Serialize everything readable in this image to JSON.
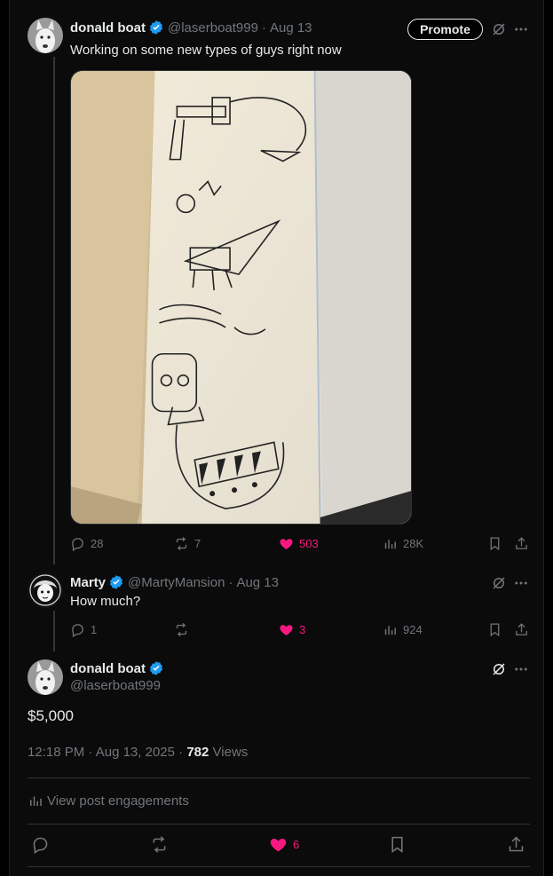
{
  "tweet1": {
    "name": "donald boat",
    "handle": "@laserboat999",
    "date": "Aug 13",
    "promote_label": "Promote",
    "text": "Working on some new types of guys right now",
    "replies": "28",
    "reposts": "7",
    "likes": "503",
    "views": "28K"
  },
  "tweet2": {
    "name": "Marty",
    "handle": "@MartyMansion",
    "date": "Aug 13",
    "text": "How much?",
    "replies": "1",
    "reposts": "",
    "likes": "3",
    "views": "924"
  },
  "tweet3": {
    "name": "donald boat",
    "handle": "@laserboat999",
    "text": "$5,000",
    "time": "12:18 PM",
    "date": "Aug 13, 2025",
    "views_count": "782",
    "views_label": "Views",
    "engagements_label": "View post engagements",
    "likes": "6"
  },
  "colors": {
    "accent_like": "#f91880",
    "verified": "#1d9bf0",
    "muted": "#71767b",
    "text": "#e7e9ea"
  },
  "icons": [
    "verified-badge-icon",
    "grok-icon",
    "more-icon",
    "reply-icon",
    "repost-icon",
    "heart-icon",
    "views-icon",
    "bookmark-icon",
    "share-icon"
  ]
}
